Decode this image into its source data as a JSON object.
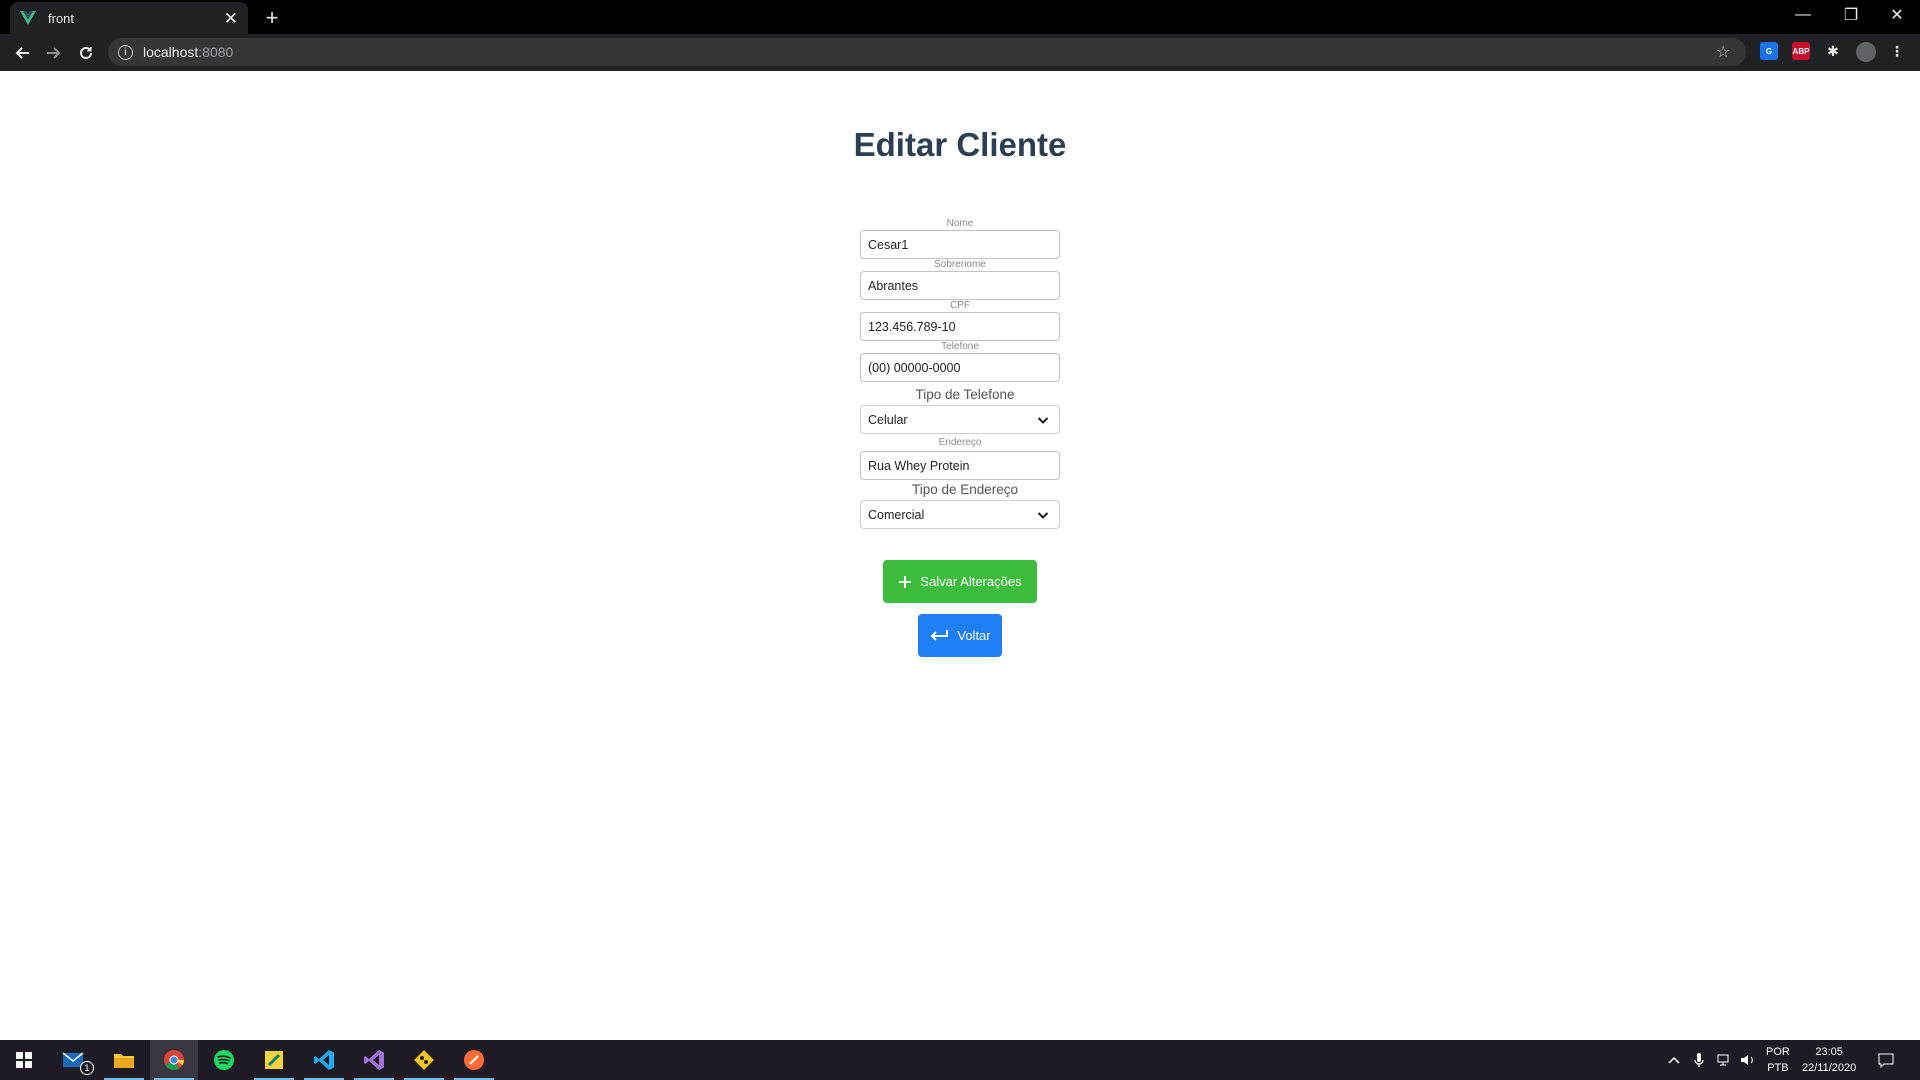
{
  "browser": {
    "tab_title": "front",
    "url_host": "localhost",
    "url_port": ":8080",
    "abp_label": "ABP"
  },
  "page": {
    "title": "Editar Cliente"
  },
  "form": {
    "nome": {
      "label": "Nome",
      "value": "Cesar1"
    },
    "sobrenome": {
      "label": "Sobrenome",
      "value": "Abrantes"
    },
    "cpf": {
      "label": "CPF",
      "value": "123.456.789-10"
    },
    "telefone": {
      "label": "Telefone",
      "value": "(00) 00000-0000"
    },
    "tipo_telefone": {
      "label": "Tipo de Telefone",
      "selected": "Celular"
    },
    "endereco": {
      "label": "Endereço",
      "value": "Rua Whey Protein"
    },
    "tipo_endereco": {
      "label": "Tipo de Endereço",
      "selected": "Comercial"
    }
  },
  "buttons": {
    "save": "Salvar Alterações",
    "back": "Voltar"
  },
  "taskbar": {
    "mail_badge": "1",
    "lang_top": "POR",
    "lang_bottom": "PTB",
    "time": "23:05",
    "date": "22/11/2020"
  },
  "colors": {
    "title": "#2c3e50",
    "save_button": "#3dbb3d",
    "back_button": "#1e7ef4"
  }
}
